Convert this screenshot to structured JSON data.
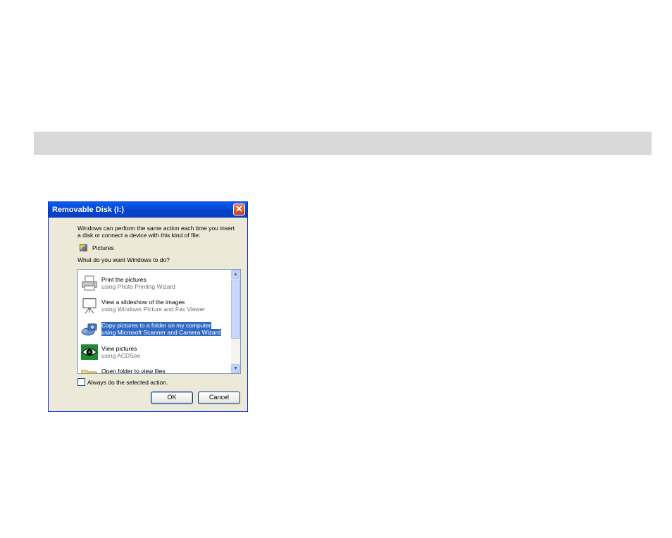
{
  "dialog": {
    "title": "Removable Disk (I:)",
    "close_glyph": "✕",
    "intro_line1": "Windows can perform the same action each time you insert",
    "intro_line2": "a disk or connect a device with this kind of file:",
    "content_type": "Pictures",
    "prompt": "What do you want Windows to do?",
    "actions": [
      {
        "title": "Print the pictures",
        "subtitle": "using Photo Printing Wizard",
        "icon": "printer-icon",
        "selected": false
      },
      {
        "title": "View a slideshow of the images",
        "subtitle": "using Windows Picture and Fax Viewer",
        "icon": "slideshow-projector-icon",
        "selected": false
      },
      {
        "title": "Copy pictures to a folder on my computer",
        "subtitle": "using Microsoft Scanner and Camera Wizard",
        "icon": "camera-wizard-icon",
        "selected": true
      },
      {
        "title": "View pictures",
        "subtitle": "using ACDSee",
        "icon": "acdsee-eye-icon",
        "selected": false
      },
      {
        "title": "Open folder to view files",
        "subtitle": "",
        "icon": "folder-icon",
        "selected": false
      }
    ],
    "always_label": "Always do the selected action.",
    "always_checked": false,
    "ok_label": "OK",
    "cancel_label": "Cancel"
  },
  "colors": {
    "title_bar": "#0a5df0",
    "selection": "#316ac5",
    "dialog_bg": "#ece9d8",
    "band": "#d9d9d9"
  }
}
